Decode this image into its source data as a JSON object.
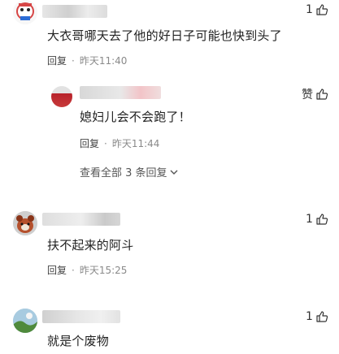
{
  "comments": [
    {
      "content": "大衣哥哪天去了他的好日子可能也快到头了",
      "reply_label": "回复",
      "time": "昨天11:40",
      "like_count": "1",
      "replies": [
        {
          "content": "媳妇儿会不会跑了！",
          "reply_label": "回复",
          "time": "昨天11:44",
          "like_label": "赞"
        }
      ],
      "view_all_replies": "查看全部 3 条回复"
    },
    {
      "content": "扶不起来的阿斗",
      "reply_label": "回复",
      "time": "昨天15:25",
      "like_count": "1"
    },
    {
      "content": "就是个废物",
      "like_count": "1"
    }
  ],
  "colors": {
    "text_primary": "#222222",
    "text_meta": "#8a8a8a",
    "avatar_red": "#c0392b"
  },
  "icons": [
    "thumbs-up-icon",
    "chevron-down-icon"
  ]
}
